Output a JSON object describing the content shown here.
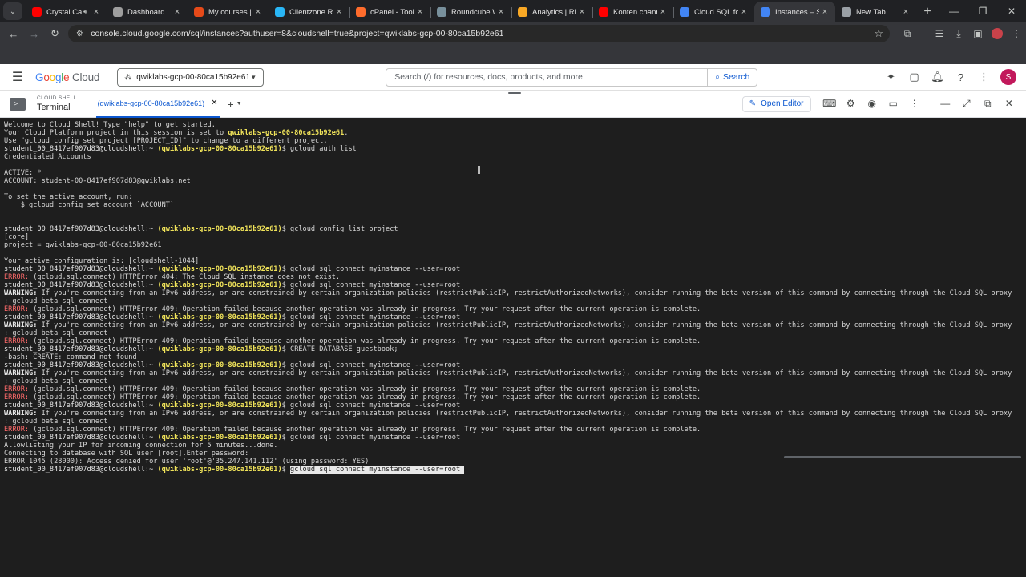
{
  "browser": {
    "tabs": [
      {
        "title": "Crystal Ca",
        "icon": "youtube-icon",
        "color": "#ff0000",
        "audio": true
      },
      {
        "title": "Dashboard",
        "icon": "dashboard-icon",
        "color": "#9e9e9e"
      },
      {
        "title": "My courses | Pe",
        "icon": "pe-icon",
        "color": "#e64a19"
      },
      {
        "title": "Clientzone Run",
        "icon": "cloud-icon",
        "color": "#29b6f6"
      },
      {
        "title": "cPanel - Tools",
        "icon": "cpanel-icon",
        "color": "#ff6c2c"
      },
      {
        "title": "Roundcube We",
        "icon": "roundcube-icon",
        "color": "#78909c"
      },
      {
        "title": "Analytics | Ring",
        "icon": "analytics-icon",
        "color": "#f9a825"
      },
      {
        "title": "Konten channe",
        "icon": "youtube-icon",
        "color": "#ff0000"
      },
      {
        "title": "Cloud SQL for",
        "icon": "google-cloud-icon",
        "color": "#4285f4"
      },
      {
        "title": "Instances – SQL",
        "icon": "sql-icon",
        "color": "#4285f4",
        "active": true
      },
      {
        "title": "New Tab",
        "icon": "globe-icon",
        "color": "#9aa0a6"
      }
    ],
    "url": "console.cloud.google.com/sql/instances?authuser=8&cloudshell=true&project=qwiklabs-gcp-00-80ca15b92e61"
  },
  "gc_header": {
    "logo_google": "Google",
    "logo_cloud": "Cloud",
    "project": "qwiklabs-gcp-00-80ca15b92e61",
    "search_placeholder": "Search (/) for resources, docs, products, and more",
    "search_button": "Search",
    "avatar_letter": "S"
  },
  "cloud_shell": {
    "section_label": "CLOUD SHELL",
    "title": "Terminal",
    "tab_label": "(qwiklabs-gcp-00-80ca15b92e61)",
    "open_editor": "Open Editor"
  },
  "terminal": {
    "user_prompt": "student_00_8417ef907d83@cloudshell:~",
    "project_tag": "(qwiklabs-gcp-00-80ca15b92e61)",
    "lines": [
      {
        "t": "plain",
        "text": "Welcome to Cloud Shell! Type \"help\" to get started."
      },
      {
        "t": "proj",
        "pre": "Your Cloud Platform project in this session is set to ",
        "proj": "qwiklabs-gcp-00-80ca15b92e61",
        "post": "."
      },
      {
        "t": "plain",
        "text": "Use \"gcloud config set project [PROJECT_ID]\" to change to a different project."
      },
      {
        "t": "prompt",
        "cmd": "gcloud auth list"
      },
      {
        "t": "plain",
        "text": "Credentialed Accounts"
      },
      {
        "t": "plain",
        "text": ""
      },
      {
        "t": "plain",
        "text": "ACTIVE: *"
      },
      {
        "t": "plain",
        "text": "ACCOUNT: student-00-8417ef907d83@qwiklabs.net"
      },
      {
        "t": "plain",
        "text": ""
      },
      {
        "t": "plain",
        "text": "To set the active account, run:"
      },
      {
        "t": "plain",
        "text": "    $ gcloud config set account `ACCOUNT`"
      },
      {
        "t": "plain",
        "text": ""
      },
      {
        "t": "plain",
        "text": ""
      },
      {
        "t": "prompt",
        "cmd": "gcloud config list project"
      },
      {
        "t": "plain",
        "text": "[core]"
      },
      {
        "t": "plain",
        "text": "project = qwiklabs-gcp-00-80ca15b92e61"
      },
      {
        "t": "plain",
        "text": ""
      },
      {
        "t": "plain",
        "text": "Your active configuration is: [cloudshell-1044]"
      },
      {
        "t": "prompt",
        "cmd": "gcloud sql connect myinstance --user=root"
      },
      {
        "t": "error",
        "text": " (gcloud.sql.connect) HTTPError 404: The Cloud SQL instance does not exist."
      },
      {
        "t": "prompt",
        "cmd": "gcloud sql connect myinstance --user=root"
      },
      {
        "t": "warning",
        "text": " If you're connecting from an IPv6 address, or are constrained by certain organization policies (restrictPublicIP, restrictAuthorizedNetworks), consider running the beta version of this command by connecting through the Cloud SQL proxy"
      },
      {
        "t": "plain",
        "text": ": gcloud beta sql connect"
      },
      {
        "t": "error",
        "text": " (gcloud.sql.connect) HTTPError 409: Operation failed because another operation was already in progress. Try your request after the current operation is complete."
      },
      {
        "t": "prompt",
        "cmd": "gcloud sql connect myinstance --user=root"
      },
      {
        "t": "warning",
        "text": " If you're connecting from an IPv6 address, or are constrained by certain organization policies (restrictPublicIP, restrictAuthorizedNetworks), consider running the beta version of this command by connecting through the Cloud SQL proxy"
      },
      {
        "t": "plain",
        "text": ": gcloud beta sql connect"
      },
      {
        "t": "error",
        "text": " (gcloud.sql.connect) HTTPError 409: Operation failed because another operation was already in progress. Try your request after the current operation is complete."
      },
      {
        "t": "prompt",
        "cmd": "CREATE DATABASE guestbook;"
      },
      {
        "t": "plain",
        "text": "-bash: CREATE: command not found"
      },
      {
        "t": "prompt",
        "cmd": "gcloud sql connect myinstance --user=root"
      },
      {
        "t": "warning",
        "text": " If you're connecting from an IPv6 address, or are constrained by certain organization policies (restrictPublicIP, restrictAuthorizedNetworks), consider running the beta version of this command by connecting through the Cloud SQL proxy"
      },
      {
        "t": "plain",
        "text": ": gcloud beta sql connect"
      },
      {
        "t": "error",
        "text": " (gcloud.sql.connect) HTTPError 409: Operation failed because another operation was already in progress. Try your request after the current operation is complete."
      },
      {
        "t": "error",
        "text": " (gcloud.sql.connect) HTTPError 409: Operation failed because another operation was already in progress. Try your request after the current operation is complete."
      },
      {
        "t": "prompt",
        "cmd": "gcloud sql connect myinstance --user=root"
      },
      {
        "t": "warning",
        "text": " If you're connecting from an IPv6 address, or are constrained by certain organization policies (restrictPublicIP, restrictAuthorizedNetworks), consider running the beta version of this command by connecting through the Cloud SQL proxy"
      },
      {
        "t": "plain",
        "text": ": gcloud beta sql connect"
      },
      {
        "t": "error",
        "text": " (gcloud.sql.connect) HTTPError 409: Operation failed because another operation was already in progress. Try your request after the current operation is complete."
      },
      {
        "t": "prompt",
        "cmd": "gcloud sql connect myinstance --user=root"
      },
      {
        "t": "plain",
        "text": "Allowlisting your IP for incoming connection for 5 minutes...done."
      },
      {
        "t": "plain",
        "text": "Connecting to database with SQL user [root].Enter password:"
      },
      {
        "t": "plain",
        "text": "ERROR 1045 (28000): Access denied for user 'root'@'35.247.141.112' (using password: YES)"
      },
      {
        "t": "prompt_sel",
        "cmd": "gcloud sql connect myinstance --user=root "
      }
    ],
    "error_label": "ERROR:",
    "warning_label": "WARNING:"
  }
}
